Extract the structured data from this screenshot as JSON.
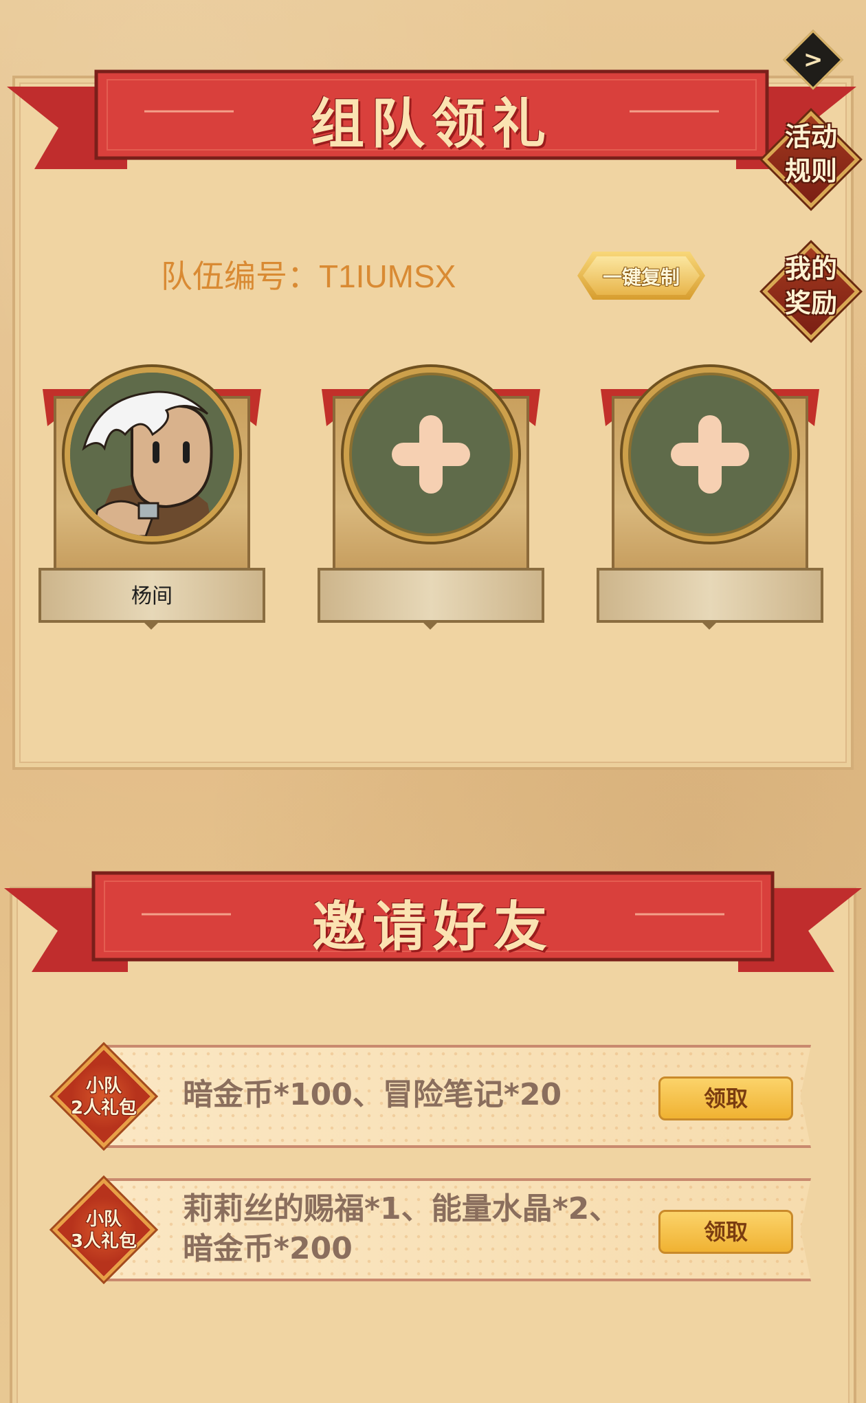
{
  "team_section": {
    "title": "组队领礼",
    "team_id_label": "队伍编号：T1IUMSX",
    "copy_button": "一键复制",
    "members": [
      {
        "name": "杨间",
        "filled": true
      },
      {
        "name": "",
        "filled": false
      },
      {
        "name": "",
        "filled": false
      }
    ]
  },
  "side_buttons": {
    "rules": "活动\n规则",
    "my_rewards": "我的\n奖励",
    "next_icon": "chevron-right-icon"
  },
  "invite_section": {
    "title": "邀请好友",
    "rewards": [
      {
        "badge": "小队\n2人礼包",
        "desc": "暗金币*100、冒险笔记*20",
        "button": "领取"
      },
      {
        "badge": "小队\n3人礼包",
        "desc": "莉莉丝的赐福*1、能量水晶*2、\n暗金币*200",
        "button": "领取"
      }
    ]
  },
  "colors": {
    "ribbon_red": "#d43a3a",
    "panel_bg": "#f0d4a2",
    "accent_orange": "#d98a33",
    "claim_yellow": "#f6c24a"
  }
}
